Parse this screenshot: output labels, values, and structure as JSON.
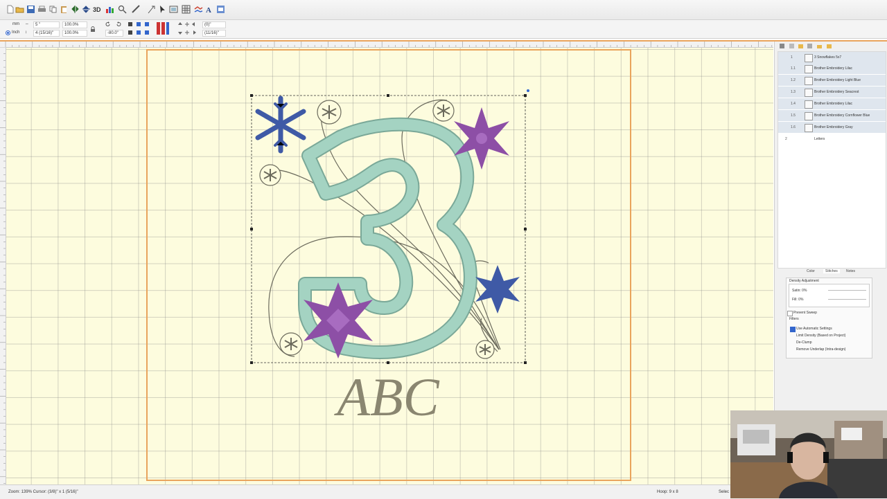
{
  "toolbar": {
    "unit_mm": "mm",
    "unit_inch": "Inch",
    "width_value": "5 \"",
    "width_pct": "100.0%",
    "height_value": "4 (15/16)\"",
    "height_pct": "100.0%",
    "rotation_value": "-80.0\"",
    "pos_x": "(0)\"",
    "pos_y": "(11/16)\""
  },
  "layers": [
    {
      "index": "1",
      "label": "3 Snowflakes 5x7"
    },
    {
      "index": "1.1",
      "label": "Brother Embroidery Lilac"
    },
    {
      "index": "1.2",
      "label": "Brother Embroidery Light Blue"
    },
    {
      "index": "1.3",
      "label": "Brother Embroidery Seacrest"
    },
    {
      "index": "1.4",
      "label": "Brother Embroidery Lilac"
    },
    {
      "index": "1.5",
      "label": "Brother Embroidery Cornflower Blue"
    },
    {
      "index": "1.6",
      "label": "Brother Embroidery Gray"
    },
    {
      "index": "2",
      "label": "Letters"
    }
  ],
  "tabs": [
    "Color",
    "Stitches",
    "Notes"
  ],
  "properties": {
    "density_title": "Density Adjustment",
    "satin": "Satin: 0%",
    "fill": "Fill: 0%",
    "prevent_sweep": "Prevent Sweep",
    "filters_title": "Filters",
    "use_auto": "Use Automatic Settings",
    "limit_density": "Limit Density (Based on Project)",
    "de_clump": "De-Clump",
    "remove_underlap": "Remove Underlap (Intra-design)"
  },
  "design": {
    "lettering": "ABC"
  },
  "status": {
    "zoom_cursor": "Zoom: 139% Cursor: (3/8)\" x 1 (5/16)\"",
    "hoop": "Hoop: 9 x 8",
    "selection": "Selec"
  },
  "colors": {
    "seacrest": "#a4d3c2",
    "outline_green": "#7aa898",
    "lilac": "#8d4fa6",
    "cornflower": "#3f5aa6",
    "gray": "#8a8670",
    "hoop_orange": "#e9a45c",
    "canvas": "#fdfcde"
  }
}
